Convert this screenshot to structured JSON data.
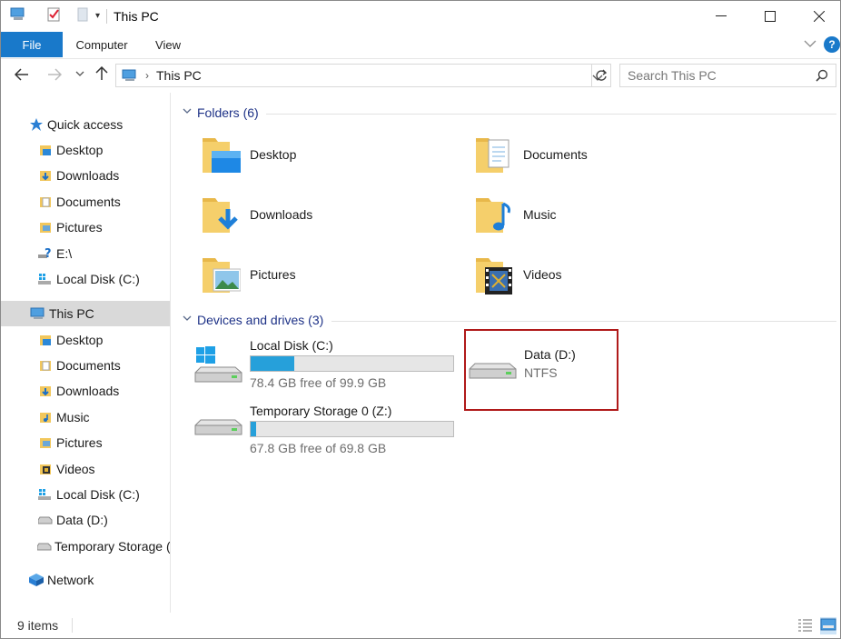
{
  "window": {
    "title": "This PC"
  },
  "ribbon": {
    "tabs": [
      "File",
      "Computer",
      "View"
    ]
  },
  "address": {
    "location": "This PC"
  },
  "search": {
    "placeholder": "Search This PC"
  },
  "sidebar": {
    "quick_access": "Quick access",
    "quick_items": [
      "Desktop",
      "Downloads",
      "Documents",
      "Pictures",
      "E:\\",
      "Local Disk (C:)"
    ],
    "this_pc": "This PC",
    "pc_items": [
      "Desktop",
      "Documents",
      "Downloads",
      "Music",
      "Pictures",
      "Videos",
      "Local Disk (C:)",
      "Data (D:)",
      "Temporary Storage (Z:)"
    ],
    "network": "Network"
  },
  "main": {
    "folders_header": "Folders (6)",
    "folders": [
      "Desktop",
      "Documents",
      "Downloads",
      "Music",
      "Pictures",
      "Videos"
    ],
    "drives_header": "Devices and drives (3)",
    "drives": [
      {
        "name": "Local Disk (C:)",
        "free": "78.4 GB free of 99.9 GB",
        "used_fraction": 0.215
      },
      {
        "name": "Temporary Storage 0 (Z:)",
        "free": "67.8 GB free of 69.8 GB",
        "used_fraction": 0.029
      },
      {
        "name": "Data (D:)",
        "fs": "NTFS"
      }
    ]
  },
  "status": {
    "items": "9 items"
  },
  "colors": {
    "accent": "#1979ca",
    "bar_fill": "#26a0da",
    "highlight": "#b01a1a",
    "group_header": "#1e3287"
  }
}
